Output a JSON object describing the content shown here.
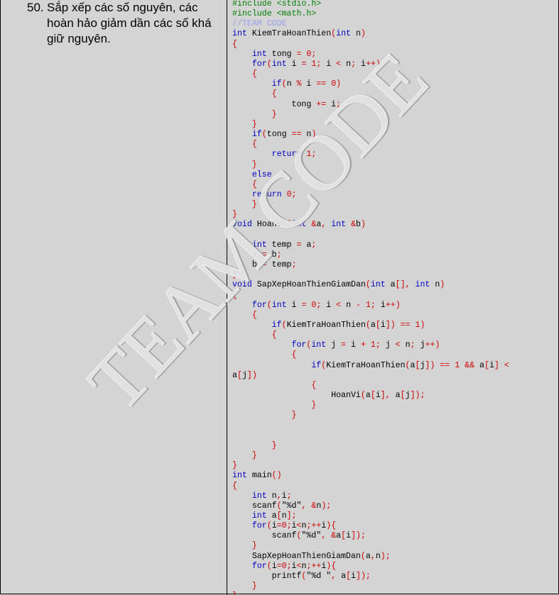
{
  "problem": {
    "number": "50.",
    "lines": [
      "Sắp xếp các số nguyên, các",
      "hoàn hảo giảm dần các số khá",
      "giữ nguyên."
    ]
  },
  "watermark": "TEAM CODE",
  "code_lines": [
    [
      [
        "pp",
        "#include <stdio.h>"
      ]
    ],
    [
      [
        "pp",
        "#include <math.h>"
      ]
    ],
    [
      [
        "cm",
        "//TEAM CODE"
      ]
    ],
    [
      [
        "kw",
        "int"
      ],
      [
        "t",
        " KiemTraHoanThien"
      ],
      [
        "op",
        "("
      ],
      [
        "kw",
        "int"
      ],
      [
        "t",
        " n"
      ],
      [
        "op",
        ")"
      ]
    ],
    [
      [
        "op",
        "{"
      ]
    ],
    [
      [
        "t",
        "    "
      ],
      [
        "kw",
        "int"
      ],
      [
        "t",
        " tong "
      ],
      [
        "op",
        "="
      ],
      [
        "t",
        " "
      ],
      [
        "op",
        "0;"
      ]
    ],
    [
      [
        "t",
        "    "
      ],
      [
        "kw",
        "for"
      ],
      [
        "op",
        "("
      ],
      [
        "kw",
        "int"
      ],
      [
        "t",
        " i "
      ],
      [
        "op",
        "="
      ],
      [
        "t",
        " "
      ],
      [
        "op",
        "1;"
      ],
      [
        "t",
        " i "
      ],
      [
        "op",
        "<"
      ],
      [
        "t",
        " n"
      ],
      [
        "op",
        ";"
      ],
      [
        "t",
        " i"
      ],
      [
        "op",
        "++)"
      ]
    ],
    [
      [
        "t",
        "    "
      ],
      [
        "op",
        "{"
      ]
    ],
    [
      [
        "t",
        "        "
      ],
      [
        "kw",
        "if"
      ],
      [
        "op",
        "("
      ],
      [
        "t",
        "n "
      ],
      [
        "op",
        "%"
      ],
      [
        "t",
        " i "
      ],
      [
        "op",
        "=="
      ],
      [
        "t",
        " "
      ],
      [
        "op",
        "0)"
      ]
    ],
    [
      [
        "t",
        "        "
      ],
      [
        "op",
        "{"
      ]
    ],
    [
      [
        "t",
        "            tong "
      ],
      [
        "op",
        "+="
      ],
      [
        "t",
        " i"
      ],
      [
        "op",
        ";"
      ]
    ],
    [
      [
        "t",
        "        "
      ],
      [
        "op",
        "}"
      ]
    ],
    [
      [
        "t",
        "    "
      ],
      [
        "op",
        "}"
      ]
    ],
    [
      [
        "t",
        "    "
      ],
      [
        "kw",
        "if"
      ],
      [
        "op",
        "("
      ],
      [
        "t",
        "tong "
      ],
      [
        "op",
        "=="
      ],
      [
        "t",
        " n"
      ],
      [
        "op",
        ")"
      ]
    ],
    [
      [
        "t",
        "    "
      ],
      [
        "op",
        "{"
      ]
    ],
    [
      [
        "t",
        "        "
      ],
      [
        "kw",
        "return"
      ],
      [
        "t",
        " "
      ],
      [
        "op",
        "1;"
      ]
    ],
    [
      [
        "t",
        "    "
      ],
      [
        "op",
        "}"
      ]
    ],
    [
      [
        "t",
        "    "
      ],
      [
        "kw",
        "else"
      ]
    ],
    [
      [
        "t",
        "    "
      ],
      [
        "op",
        "{"
      ]
    ],
    [
      [
        "t",
        "    "
      ],
      [
        "kw",
        "return"
      ],
      [
        "t",
        " "
      ],
      [
        "op",
        "0;"
      ]
    ],
    [
      [
        "t",
        "    "
      ],
      [
        "op",
        "}"
      ]
    ],
    [
      [
        "op",
        "}"
      ]
    ],
    [
      [
        "kw",
        "void"
      ],
      [
        "t",
        " HoanVi"
      ],
      [
        "op",
        "("
      ],
      [
        "kw",
        "int"
      ],
      [
        "t",
        " "
      ],
      [
        "op",
        "&"
      ],
      [
        "t",
        "a"
      ],
      [
        "op",
        ","
      ],
      [
        "t",
        " "
      ],
      [
        "kw",
        "int"
      ],
      [
        "t",
        " "
      ],
      [
        "op",
        "&"
      ],
      [
        "t",
        "b"
      ],
      [
        "op",
        ")"
      ]
    ],
    [
      [
        "op",
        "{"
      ]
    ],
    [
      [
        "t",
        "    "
      ],
      [
        "kw",
        "int"
      ],
      [
        "t",
        " temp "
      ],
      [
        "op",
        "="
      ],
      [
        "t",
        " a"
      ],
      [
        "op",
        ";"
      ]
    ],
    [
      [
        "t",
        "    a "
      ],
      [
        "op",
        "="
      ],
      [
        "t",
        " b"
      ],
      [
        "op",
        ";"
      ]
    ],
    [
      [
        "t",
        "    b "
      ],
      [
        "op",
        "="
      ],
      [
        "t",
        " temp"
      ],
      [
        "op",
        ";"
      ]
    ],
    [
      [
        "op",
        "}"
      ]
    ],
    [
      [
        "kw",
        "void"
      ],
      [
        "t",
        " SapXepHoanThienGiamDan"
      ],
      [
        "op",
        "("
      ],
      [
        "kw",
        "int"
      ],
      [
        "t",
        " a"
      ],
      [
        "op",
        "[],"
      ],
      [
        "t",
        " "
      ],
      [
        "kw",
        "int"
      ],
      [
        "t",
        " n"
      ],
      [
        "op",
        ")"
      ]
    ],
    [
      [
        "op",
        "{"
      ]
    ],
    [
      [
        "t",
        "    "
      ],
      [
        "kw",
        "for"
      ],
      [
        "op",
        "("
      ],
      [
        "kw",
        "int"
      ],
      [
        "t",
        " i "
      ],
      [
        "op",
        "="
      ],
      [
        "t",
        " "
      ],
      [
        "op",
        "0;"
      ],
      [
        "t",
        " i "
      ],
      [
        "op",
        "<"
      ],
      [
        "t",
        " n "
      ],
      [
        "op",
        "-"
      ],
      [
        "t",
        " "
      ],
      [
        "op",
        "1;"
      ],
      [
        "t",
        " i"
      ],
      [
        "op",
        "++)"
      ]
    ],
    [
      [
        "t",
        "    "
      ],
      [
        "op",
        "{"
      ]
    ],
    [
      [
        "t",
        "        "
      ],
      [
        "kw",
        "if"
      ],
      [
        "op",
        "("
      ],
      [
        "t",
        "KiemTraHoanThien"
      ],
      [
        "op",
        "("
      ],
      [
        "t",
        "a"
      ],
      [
        "op",
        "["
      ],
      [
        "t",
        "i"
      ],
      [
        "op",
        "])"
      ],
      [
        "t",
        " "
      ],
      [
        "op",
        "=="
      ],
      [
        "t",
        " "
      ],
      [
        "op",
        "1)"
      ]
    ],
    [
      [
        "t",
        "        "
      ],
      [
        "op",
        "{"
      ]
    ],
    [
      [
        "t",
        "            "
      ],
      [
        "kw",
        "for"
      ],
      [
        "op",
        "("
      ],
      [
        "kw",
        "int"
      ],
      [
        "t",
        " j "
      ],
      [
        "op",
        "="
      ],
      [
        "t",
        " i "
      ],
      [
        "op",
        "+"
      ],
      [
        "t",
        " "
      ],
      [
        "op",
        "1;"
      ],
      [
        "t",
        " j "
      ],
      [
        "op",
        "<"
      ],
      [
        "t",
        " n"
      ],
      [
        "op",
        ";"
      ],
      [
        "t",
        " j"
      ],
      [
        "op",
        "++)"
      ]
    ],
    [
      [
        "t",
        "            "
      ],
      [
        "op",
        "{"
      ]
    ],
    [
      [
        "t",
        "                "
      ],
      [
        "kw",
        "if"
      ],
      [
        "op",
        "("
      ],
      [
        "t",
        "KiemTraHoanThien"
      ],
      [
        "op",
        "("
      ],
      [
        "t",
        "a"
      ],
      [
        "op",
        "["
      ],
      [
        "t",
        "j"
      ],
      [
        "op",
        "])"
      ],
      [
        "t",
        " "
      ],
      [
        "op",
        "=="
      ],
      [
        "t",
        " "
      ],
      [
        "op",
        "1"
      ],
      [
        "t",
        " "
      ],
      [
        "op",
        "&&"
      ],
      [
        "t",
        " a"
      ],
      [
        "op",
        "["
      ],
      [
        "t",
        "i"
      ],
      [
        "op",
        "]"
      ],
      [
        "t",
        " "
      ],
      [
        "op",
        "<"
      ]
    ],
    [
      [
        "t",
        "a"
      ],
      [
        "op",
        "["
      ],
      [
        "t",
        "j"
      ],
      [
        "op",
        "])"
      ]
    ],
    [
      [
        "t",
        "                "
      ],
      [
        "op",
        "{"
      ]
    ],
    [
      [
        "t",
        "                    HoanVi"
      ],
      [
        "op",
        "("
      ],
      [
        "t",
        "a"
      ],
      [
        "op",
        "["
      ],
      [
        "t",
        "i"
      ],
      [
        "op",
        "],"
      ],
      [
        "t",
        " a"
      ],
      [
        "op",
        "["
      ],
      [
        "t",
        "j"
      ],
      [
        "op",
        "]);"
      ]
    ],
    [
      [
        "t",
        "                "
      ],
      [
        "op",
        "}"
      ]
    ],
    [
      [
        "t",
        "            "
      ],
      [
        "op",
        "}"
      ]
    ],
    [
      [
        "t",
        ""
      ]
    ],
    [
      [
        "t",
        ""
      ]
    ],
    [
      [
        "t",
        "        "
      ],
      [
        "op",
        "}"
      ]
    ],
    [
      [
        "t",
        "    "
      ],
      [
        "op",
        "}"
      ]
    ],
    [
      [
        "op",
        "}"
      ]
    ],
    [
      [
        "kw",
        "int"
      ],
      [
        "t",
        " main"
      ],
      [
        "op",
        "()"
      ]
    ],
    [
      [
        "op",
        "{"
      ]
    ],
    [
      [
        "t",
        "    "
      ],
      [
        "kw",
        "int"
      ],
      [
        "t",
        " n"
      ],
      [
        "op",
        ","
      ],
      [
        "t",
        "i"
      ],
      [
        "op",
        ";"
      ]
    ],
    [
      [
        "t",
        "    scanf"
      ],
      [
        "op",
        "("
      ],
      [
        "t",
        "\"%d\""
      ],
      [
        "op",
        ","
      ],
      [
        "t",
        " "
      ],
      [
        "op",
        "&"
      ],
      [
        "t",
        "n"
      ],
      [
        "op",
        ");"
      ]
    ],
    [
      [
        "t",
        "    "
      ],
      [
        "kw",
        "int"
      ],
      [
        "t",
        " a"
      ],
      [
        "op",
        "["
      ],
      [
        "t",
        "n"
      ],
      [
        "op",
        "];"
      ]
    ],
    [
      [
        "t",
        "    "
      ],
      [
        "kw",
        "for"
      ],
      [
        "op",
        "("
      ],
      [
        "t",
        "i"
      ],
      [
        "op",
        "=0;"
      ],
      [
        "t",
        "i"
      ],
      [
        "op",
        "<"
      ],
      [
        "t",
        "n"
      ],
      [
        "op",
        ";++"
      ],
      [
        "t",
        "i"
      ],
      [
        "op",
        "){"
      ]
    ],
    [
      [
        "t",
        "        scanf"
      ],
      [
        "op",
        "("
      ],
      [
        "t",
        "\"%d\""
      ],
      [
        "op",
        ","
      ],
      [
        "t",
        " "
      ],
      [
        "op",
        "&"
      ],
      [
        "t",
        "a"
      ],
      [
        "op",
        "["
      ],
      [
        "t",
        "i"
      ],
      [
        "op",
        "]);"
      ]
    ],
    [
      [
        "t",
        "    "
      ],
      [
        "op",
        "}"
      ]
    ],
    [
      [
        "t",
        "    SapXepHoanThienGiamDan"
      ],
      [
        "op",
        "("
      ],
      [
        "t",
        "a"
      ],
      [
        "op",
        ","
      ],
      [
        "t",
        "n"
      ],
      [
        "op",
        ");"
      ]
    ],
    [
      [
        "t",
        "    "
      ],
      [
        "kw",
        "for"
      ],
      [
        "op",
        "("
      ],
      [
        "t",
        "i"
      ],
      [
        "op",
        "=0;"
      ],
      [
        "t",
        "i"
      ],
      [
        "op",
        "<"
      ],
      [
        "t",
        "n"
      ],
      [
        "op",
        ";++"
      ],
      [
        "t",
        "i"
      ],
      [
        "op",
        "){"
      ]
    ],
    [
      [
        "t",
        "        printf"
      ],
      [
        "op",
        "("
      ],
      [
        "t",
        "\"%d \""
      ],
      [
        "op",
        ","
      ],
      [
        "t",
        " a"
      ],
      [
        "op",
        "["
      ],
      [
        "t",
        "i"
      ],
      [
        "op",
        "]);"
      ]
    ],
    [
      [
        "t",
        "    "
      ],
      [
        "op",
        "}"
      ]
    ],
    [
      [
        "op",
        "}"
      ]
    ]
  ]
}
